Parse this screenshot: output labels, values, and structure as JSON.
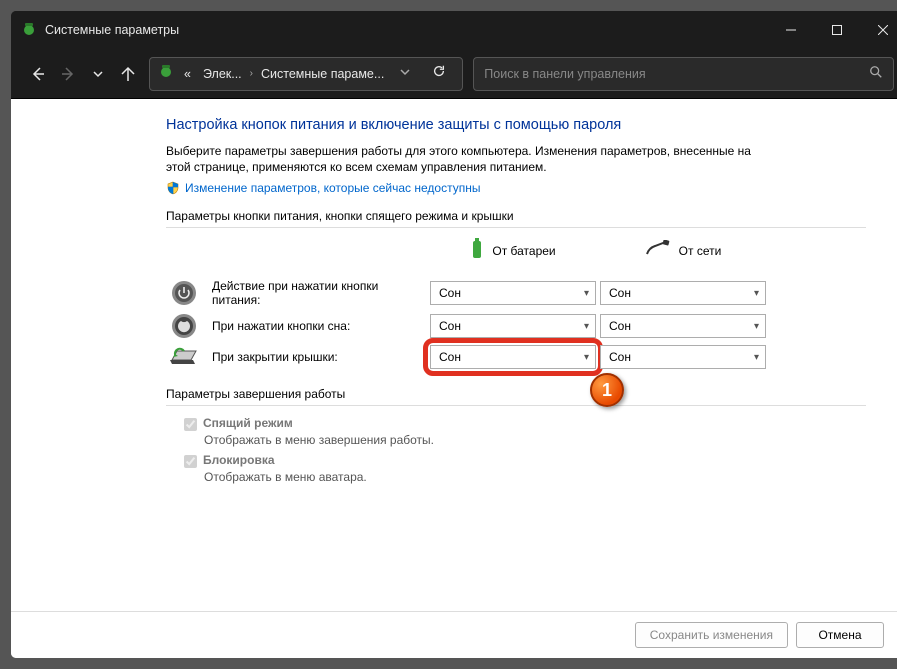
{
  "window": {
    "title": "Системные параметры"
  },
  "toolbar": {
    "crumb_prefix": "«",
    "crumb1": "Элек...",
    "crumb2": "Системные параме...",
    "search_placeholder": "Поиск в панели управления"
  },
  "main": {
    "heading": "Настройка кнопок питания и включение защиты с помощью пароля",
    "description": "Выберите параметры завершения работы для этого компьютера. Изменения параметров, внесенные на этой странице, применяются ко всем схемам управления питанием.",
    "admin_link": "Изменение параметров, которые сейчас недоступны",
    "section1_label": "Параметры кнопки питания, кнопки спящего режима и крышки",
    "col_battery": "От батареи",
    "col_plugged": "От сети",
    "rows": [
      {
        "label": "Действие при нажатии кнопки питания:",
        "battery": "Сон",
        "plugged": "Сон"
      },
      {
        "label": "При нажатии кнопки сна:",
        "battery": "Сон",
        "plugged": "Сон"
      },
      {
        "label": "При закрытии крышки:",
        "battery": "Сон",
        "plugged": "Сон"
      }
    ],
    "callout_number": "1",
    "section2_label": "Параметры завершения работы",
    "opt_sleep_label": "Спящий режим",
    "opt_sleep_desc": "Отображать в меню завершения работы.",
    "opt_lock_label": "Блокировка",
    "opt_lock_desc": "Отображать в меню аватара."
  },
  "footer": {
    "save": "Сохранить изменения",
    "cancel": "Отмена"
  }
}
